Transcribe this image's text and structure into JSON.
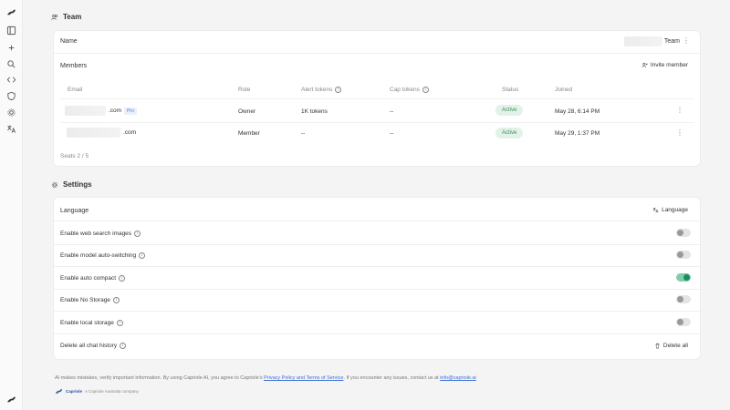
{
  "team": {
    "section_title": "Team",
    "name_label": "Name",
    "name_value": "Team",
    "members_label": "Members",
    "invite_label": "Invite member",
    "columns": [
      "Email",
      "Role",
      "Alert tokens",
      "Cap tokens",
      "Status",
      "Joined"
    ],
    "members": [
      {
        "email_suffix": ".com",
        "badge": "Pro",
        "role": "Owner",
        "alert_tokens": "1K tokens",
        "cap_tokens": "--",
        "status": "Active",
        "joined": "May 28, 6:14 PM"
      },
      {
        "email_suffix": ".com",
        "badge": "",
        "role": "Member",
        "alert_tokens": "--",
        "cap_tokens": "--",
        "status": "Active",
        "joined": "May 29, 1:37 PM"
      }
    ],
    "seats": "Seats 2 / 5"
  },
  "settings": {
    "section_title": "Settings",
    "language_label": "Language",
    "language_button": "Language",
    "rows": [
      {
        "label": "Enable web search images",
        "on": false
      },
      {
        "label": "Enable model auto-switching",
        "on": false
      },
      {
        "label": "Enable auto compact",
        "on": true
      },
      {
        "label": "Enable No Storage",
        "on": false
      },
      {
        "label": "Enable local storage",
        "on": false
      }
    ],
    "delete_label": "Delete all chat history",
    "delete_button": "Delete all"
  },
  "footer": {
    "text_before": "AI makes mistakes, verify important information. By using Capriole AI, you agree to Capriole's ",
    "link_policy": "Privacy Policy and Terms of Service",
    "text_middle": ". If you encounter any issues, contact us at ",
    "link_email": "info@capriole.ai",
    "brand_name": "Capriole",
    "brand_tag": "A Capriole Australia company"
  },
  "colors": {
    "accent_green": "#1f8a5c",
    "link_blue": "#3b6fd6"
  }
}
